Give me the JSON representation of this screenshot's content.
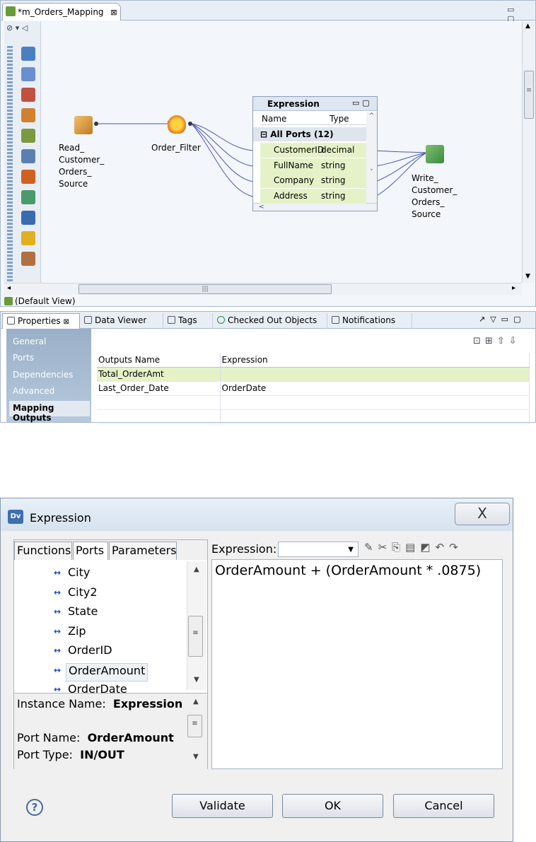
{
  "editor": {
    "tab_title": "*m_Orders_Mapping",
    "tab_close": "⊠",
    "window_buttons": "▭ ▢",
    "default_view": "(Default View)",
    "nodes": {
      "source": "Read_\nCustomer_\nOrders_\nSource",
      "filter": "Order_Filter",
      "target": "Write_\nCustomer_\nOrders_\nSource"
    },
    "expression_node": {
      "title": "Expression",
      "col_name": "Name",
      "col_type": "Type",
      "ports_header": "All Ports (12)",
      "ports": [
        {
          "name": "CustomerID",
          "type": "decimal"
        },
        {
          "name": "FullName",
          "type": "string"
        },
        {
          "name": "Company",
          "type": "string"
        },
        {
          "name": "Address",
          "type": "string"
        }
      ]
    },
    "palette_icons": [
      "read-icon",
      "write-icon",
      "lookup-icon",
      "joiner-icon",
      "router-icon",
      "union-icon",
      "sorter-icon",
      "aggregator-icon",
      "java-icon",
      "filter-icon",
      "expression-icon"
    ]
  },
  "properties": {
    "tabs": [
      {
        "label": "Properties",
        "suffix": "⊠"
      },
      {
        "label": "Data Viewer"
      },
      {
        "label": "Tags"
      },
      {
        "label": "Checked Out Objects"
      },
      {
        "label": "Notifications"
      }
    ],
    "nav": [
      "General",
      "Ports",
      "Dependencies",
      "Advanced",
      "Mapping Outputs"
    ],
    "nav_selected": "Mapping Outputs",
    "table": {
      "headers": [
        "Outputs Name",
        "Expression"
      ],
      "rows": [
        [
          "Total_OrderAmt",
          ""
        ],
        [
          "Last_Order_Date",
          "OrderDate"
        ],
        [
          "",
          ""
        ],
        [
          "",
          ""
        ]
      ]
    }
  },
  "dialog": {
    "app_icon": "Dv",
    "title": "Expression",
    "close_glyph": "X",
    "tabs": [
      "Functions",
      "Ports",
      "Parameters"
    ],
    "active_tab": "Ports",
    "ports": [
      "City",
      "City2",
      "State",
      "Zip",
      "OrderID",
      "OrderAmount",
      "OrderDate"
    ],
    "selected_port": "OrderAmount",
    "info": {
      "instance_label": "Instance Name:",
      "instance_value": "Expression",
      "port_name_label": "Port Name:",
      "port_name_value": "OrderAmount",
      "port_type_label": "Port Type:",
      "port_type_value": "IN/OUT"
    },
    "expression_label": "Expression:",
    "expression_text": "OrderAmount + (OrderAmount * .0875)",
    "buttons": {
      "validate": "Validate",
      "ok": "OK",
      "cancel": "Cancel"
    },
    "help": "?"
  },
  "colors": {
    "port_highlight": "#e5f2c8",
    "nav_bg": "#9ab0c8",
    "canvas_bg": "#f3f6fa",
    "port_arrow": "#1b4fb0"
  }
}
